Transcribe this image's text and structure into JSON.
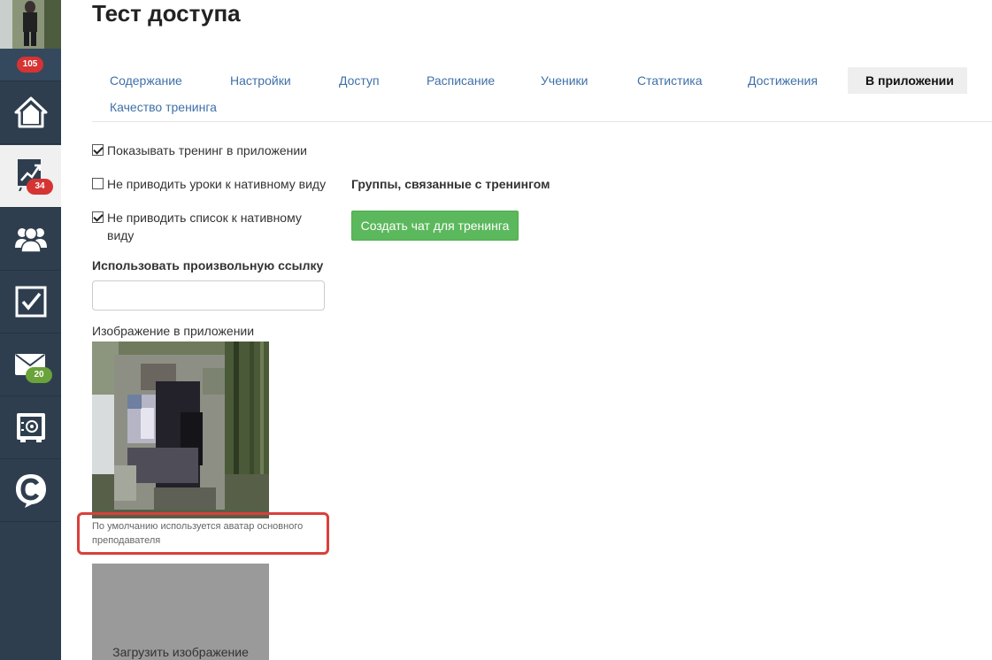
{
  "sidebar": {
    "avatar_badge": "105",
    "items": [
      {
        "name": "home-icon"
      },
      {
        "name": "chart-trend-icon",
        "badge": "34",
        "active": true
      },
      {
        "name": "users-group-icon"
      },
      {
        "name": "checkbox-task-icon"
      },
      {
        "name": "mail-icon",
        "badge": "20"
      },
      {
        "name": "safe-icon"
      },
      {
        "name": "chat-c-logo-icon"
      }
    ],
    "colors": {
      "background": "#2e3e4f",
      "badge_red": "#d63333",
      "badge_green": "#6aa33a"
    }
  },
  "page": {
    "title": "Тест доступа"
  },
  "tabs": [
    {
      "label": "Содержание"
    },
    {
      "label": "Настройки"
    },
    {
      "label": "Доступ"
    },
    {
      "label": "Расписание"
    },
    {
      "label": "Ученики"
    },
    {
      "label": "Статистика"
    },
    {
      "label": "Достижения"
    },
    {
      "label": "В приложении",
      "active": true
    },
    {
      "label": "Качество тренинга"
    }
  ],
  "settings": {
    "show_in_app": {
      "label": "Показывать тренинг в приложении",
      "checked": true
    },
    "no_native_lessons": {
      "label": "Не приводить уроки к нативному виду",
      "checked": false
    },
    "no_native_list": {
      "label": "Не приводить список к нативному виду",
      "checked": true
    },
    "custom_link_label": "Использовать произвольную ссылку",
    "custom_link_value": "",
    "image_label": "Изображение в приложении",
    "image_hint": "По умолчанию используется аватар основного преподавателя",
    "upload_label": "Загрузить изображение"
  },
  "groups": {
    "label": "Группы, связанные с тренингом",
    "create_chat_button": "Создать чат для тренинга"
  }
}
